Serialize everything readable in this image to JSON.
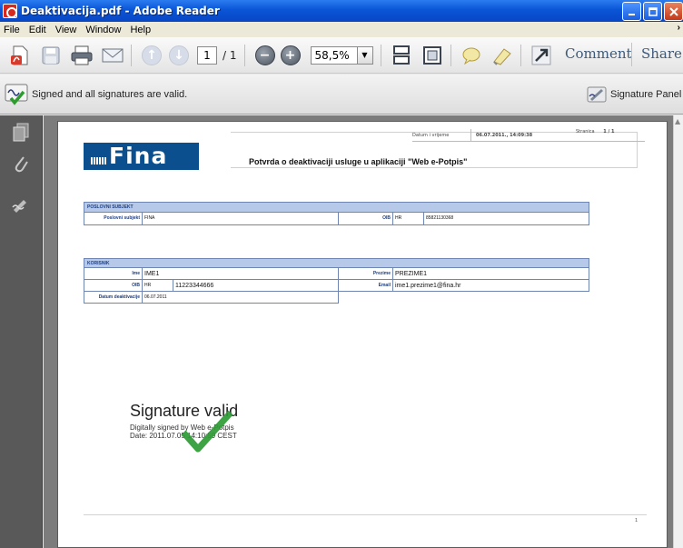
{
  "window": {
    "title": "Deaktivacija.pdf - Adobe Reader",
    "controls": [
      "minimize",
      "maximize",
      "close"
    ]
  },
  "menu": {
    "items": [
      "File",
      "Edit",
      "View",
      "Window",
      "Help"
    ]
  },
  "toolbar": {
    "page_current": "1",
    "page_total": "/ 1",
    "zoom_value": "58,5%",
    "comment_label": "Comment",
    "share_label": "Share"
  },
  "message_bar": {
    "text": "Signed and all signatures are valid.",
    "signature_panel_label": "Signature Panel"
  },
  "document": {
    "header": {
      "datetime_label": "Datum i vrijeme",
      "datetime_value": "06.07.2011., 14:09:38",
      "page_label": "Stranica",
      "page_value": "1 / 1"
    },
    "logo_text": "Fina",
    "title": "Potvrda o deaktivaciji usluge u aplikaciji \"Web e-Potpis\"",
    "section1": {
      "header": "POSLOVNI SUBJEKT",
      "subject_label": "Poslovni subjekt",
      "subject_value": "FINA",
      "oib_label": "OIB",
      "oib_country": "HR",
      "oib_value": "85821130368"
    },
    "section2": {
      "header": "KORISNIK",
      "ime_label": "Ime",
      "ime_value": "IME1",
      "prezime_label": "Prezime",
      "prezime_value": "PREZIME1",
      "oib_label": "OIB",
      "oib_country": "HR",
      "oib_value": "11223344666",
      "email_label": "Email",
      "email_value": "ime1.prezime1@fina.hr",
      "date_label": "Datum deaktivacije",
      "date_value": "06.07.2011"
    },
    "signature": {
      "title": "Signature valid",
      "line1": "Digitally signed by Web e-Potpis",
      "line2": "Date: 2011.07.05 14:10:59 CEST"
    },
    "footer_page": "1"
  }
}
